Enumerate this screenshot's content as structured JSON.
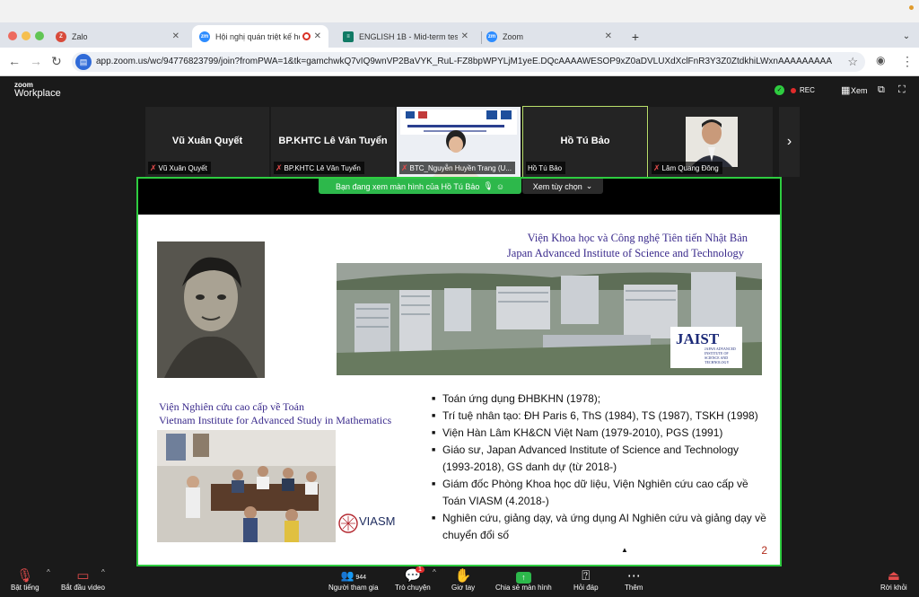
{
  "browser": {
    "tabs": [
      {
        "label": "Zalo",
        "icon": "zalo-icon",
        "color": "#c0392b"
      },
      {
        "label": "Hội nghị quán triệt kế hoạ",
        "icon": "zoom-icon",
        "color": "#2d8cff",
        "active": true
      },
      {
        "label": "ENGLISH 1B - Mid-term test (",
        "icon": "forms-icon",
        "color": "#117a65"
      },
      {
        "label": "Zoom",
        "icon": "zoom-icon",
        "color": "#2d8cff"
      }
    ],
    "url": "app.zoom.us/wc/94776823799/join?fromPWA=1&tk=gamchwkQ7vIQ9wnVP2BaVYK_RuL-FZ8bpWPYLjM1yeE.DQcAAAAWESOP9xZ0aDVLUXdXclFnR3Y3Z0ZtdkhiLWxnAAAAAAAAAAAA..."
  },
  "zoom": {
    "brand_top": "zoom",
    "brand_bottom": "Workplace",
    "rec_label": "REC",
    "view_label": "Xem"
  },
  "participants": [
    {
      "name": "Vũ Xuân Quyết",
      "label": "Vũ Xuân Quyết",
      "muted": true
    },
    {
      "name": "BP.KHTC Lê Văn Tuyển",
      "label": "BP.KHTC Lê Văn Tuyển",
      "muted": true
    },
    {
      "name": "",
      "label": "BTC_Nguyễn Huyền Trang (U...",
      "muted": true,
      "video": true
    },
    {
      "name": "Hồ Tú Bảo",
      "label": "Hồ Tú Bảo",
      "muted": false,
      "speaking": true
    },
    {
      "name": "",
      "label": "Lâm Quang Đông",
      "muted": true,
      "video": true
    }
  ],
  "share": {
    "banner": "Bạn đang xem màn hình của Hồ Tú Bảo",
    "view_options": "Xem tùy chọn"
  },
  "slide": {
    "title_vi": "Viện Khoa học và Công nghệ Tiên tiến Nhật Bản",
    "title_en": "Japan Advanced Institute of Science and Technology",
    "jaist_logo": "JAIST",
    "jaist_sub": "JAPAN ADVANCED INSTITUTE OF SCIENCE AND TECHNOLOGY",
    "viasm_vi": "Viện Nghiên cứu cao cấp về Toán",
    "viasm_en": "Vietnam Institute for Advanced Study in Mathematics",
    "viasm_logo": "VIASM",
    "bullets": [
      "Toán ứng dụng ĐHBKHN (1978);",
      "Trí tuệ nhân tạo: ĐH Paris 6, ThS (1984), TS (1987), TSKH (1998)",
      "Viện Hàn Lâm KH&CN Việt Nam (1979-2010), PGS (1991)",
      "Giáo sư, Japan Advanced Institute of Science and Technology (1993-2018), GS danh dự (từ 2018-)",
      "Giám đốc Phòng Khoa học dữ liệu, Viện Nghiên cứu cao cấp về Toán VIASM (4.2018-)",
      "Nghiên cứu, giảng dạy, và ứng dụng AI Nghiên cứu và giảng dạy về chuyển đổi số"
    ],
    "page": "2"
  },
  "toolbar": {
    "mute": "Bật tiếng",
    "video": "Bắt đầu video",
    "participants": "Người tham gia",
    "participants_count": "944",
    "chat": "Trò chuyện",
    "chat_badge": "1",
    "raise": "Giơ tay",
    "share": "Chia sẻ màn hình",
    "qa": "Hỏi đáp",
    "more": "Thêm",
    "leave": "Rời khỏi"
  }
}
